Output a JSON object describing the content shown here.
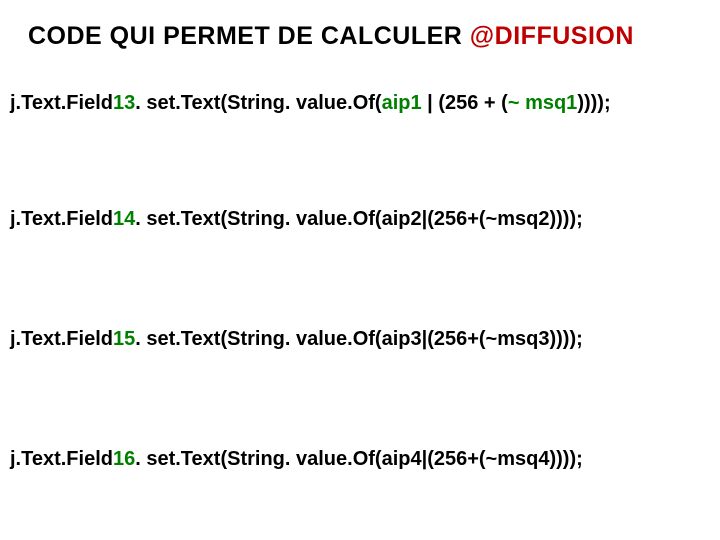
{
  "title": {
    "prefix": "CODE QUI PERMET DE CALCULER ",
    "highlight": "@DIFFUSION"
  },
  "lines": [
    {
      "p1": "j.Text.Field",
      "num": "13",
      "p2": ". set.Text(String. value.Of(",
      "arg1": "aip1",
      "p3": " | (256 + (",
      "tilde": "~",
      "p4": " ",
      "arg2": "msq1",
      "p5": "))));"
    },
    {
      "p1": "j.Text.Field",
      "num": "14",
      "p2": ". set.Text(String. value.Of(aip2|(256+(~msq2))));"
    },
    {
      "p1": "j.Text.Field",
      "num": "15",
      "p2": ". set.Text(String. value.Of(aip3|(256+(~msq3))));"
    },
    {
      "p1": "j.Text.Field",
      "num": "16",
      "p2": ". set.Text(String. value.Of(aip4|(256+(~msq4))));"
    }
  ]
}
